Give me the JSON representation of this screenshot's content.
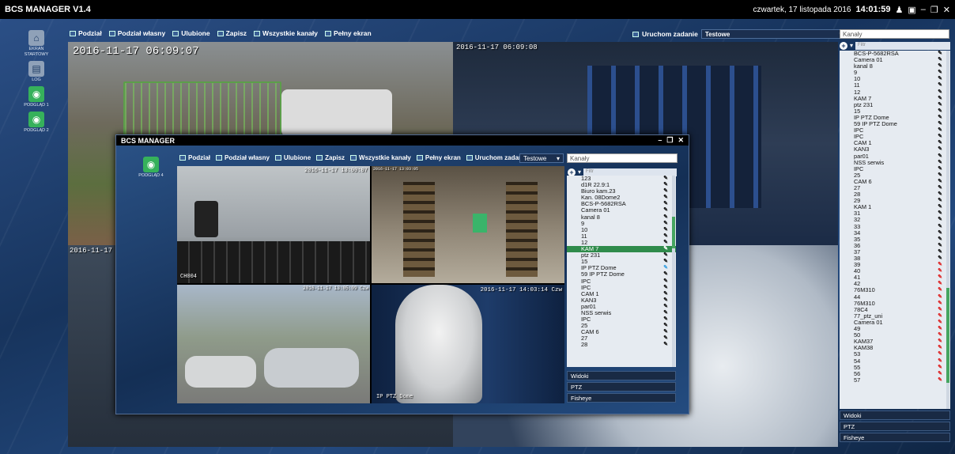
{
  "app": {
    "title": "BCS MANAGER V1.4",
    "datetime_prefix": "czwartek, 17 listopada 2016",
    "time": "14:01:59"
  },
  "nav": [
    {
      "label": "EKRAN STARTOWY",
      "icon": "home-icon",
      "glyph": "⌂"
    },
    {
      "label": "LOG",
      "icon": "log-icon",
      "glyph": "▤"
    },
    {
      "label": "PODGLĄD 1",
      "icon": "eye-icon",
      "glyph": "◉"
    },
    {
      "label": "PODGLĄD 2",
      "icon": "eye-icon",
      "glyph": "◉"
    }
  ],
  "toolbar": {
    "podzial": "Podział",
    "podzial_wlasny": "Podział własny",
    "ulubione": "Ulubione",
    "zapisz": "Zapisz",
    "wszystkie": "Wszystkie kanały",
    "pelny": "Pełny ekran"
  },
  "task": {
    "label": "Uruchom zadanie",
    "value": "Testowe"
  },
  "search": {
    "placeholder": "Kanały",
    "filter": "Filtr"
  },
  "main_cams": {
    "ts1": "2016-11-17 06:09:07",
    "ts2": "2016-11-17 06:09:08",
    "ts3": "2016-11-17"
  },
  "right_channels": [
    "BCS-P-5682RSA",
    "Camera 01",
    "kanal 8",
    "9",
    "10",
    "11",
    "12",
    "KAM 7",
    "ptz 231",
    "15",
    "IP PTZ Dome",
    "59 IP PTZ Dome",
    "IPC",
    "IPC",
    "CAM 1",
    "KAN3",
    "par01",
    "NSS serwis",
    "IPC",
    "25",
    "CAM 6",
    "27",
    "28",
    "29",
    "KAM 1",
    "31",
    "32",
    "33",
    "34",
    "35",
    "36",
    "37",
    "38",
    "39",
    "40",
    "41",
    "42",
    "76M310",
    "44",
    "76M310",
    "78C4",
    "77_ptz_uni",
    "Camera 01",
    "49",
    "50",
    "KAM37",
    "KAM38",
    "53",
    "54",
    "55",
    "56",
    "57"
  ],
  "right_red_from": 33,
  "panel": {
    "widoki": "Widoki",
    "ptz": "PTZ",
    "fisheye": "Fisheye"
  },
  "win": {
    "title": "BCS MANAGER",
    "nav_label": "PODGLĄD 4",
    "task_value": "Testowe",
    "channels": [
      "123",
      "d1R 22.9:1",
      "Biuro kam.23",
      "Kan. 08Dome2",
      "BCS-P-5682RSA",
      "Camera 01",
      "kanal 8",
      "9",
      "10",
      "11",
      "12",
      "KAM 7",
      "ptz 231",
      "15",
      "IP PTZ Dome",
      "59 IP PTZ Dome",
      "IPC",
      "IPC",
      "CAM 1",
      "KAN3",
      "par01",
      "NSS serwis",
      "IPC",
      "25",
      "CAM 6",
      "27",
      "28"
    ],
    "selected_index": 11,
    "blue_index": 14,
    "cams": {
      "a_ts": "2016-11-17 13:00:07",
      "a_name": "CH004",
      "b_ts": "2016-11-17 13:03:05",
      "c_ts": "2016-11-17 13:05:09 Czw",
      "d_ts": "2016-11-17 14:03:14 Czw",
      "d_name": "IP PTZ Dome"
    }
  }
}
